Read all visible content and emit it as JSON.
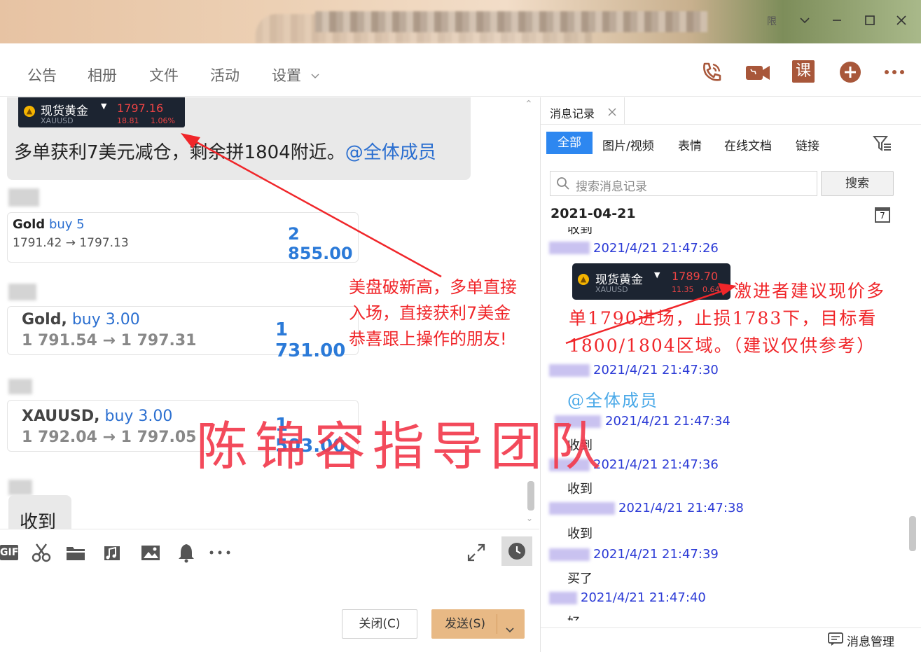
{
  "window": {
    "title_partial": "限",
    "controls": [
      "chevron-down-icon",
      "minimize-icon",
      "maximize-icon",
      "close-icon"
    ]
  },
  "toolbar": {
    "tabs": [
      "公告",
      "相册",
      "文件",
      "活动",
      "设置"
    ],
    "icons": [
      "phone-icon",
      "video-icon",
      "course-icon",
      "add-icon",
      "more-icon"
    ],
    "course_label": "课"
  },
  "chat": {
    "ticker1": {
      "name": "现货黄金",
      "symbol": "XAUUSD",
      "price": "1797.16",
      "change": "18.81",
      "pct": "1.06%"
    },
    "msg1_text": "多单获利7美元减仓，剩余拼1804附近。",
    "msg1_mention": "@全体成员",
    "trade1": {
      "sym": "Gold",
      "dir": "buy 5",
      "prices": "1791.42 → 1797.13",
      "profit": "2 855.00"
    },
    "trade2": {
      "sym": "Gold,",
      "dir": "buy 3.00",
      "prices": "1 791.54 → 1 797.31",
      "profit": "1 731.00"
    },
    "trade3": {
      "sym": "XAUUSD,",
      "dir": "buy 3.00",
      "prices": "1 792.04 → 1 797.05",
      "profit": "1 503.00"
    },
    "last_msg": "收到"
  },
  "input": {
    "tools": [
      "gif-icon",
      "scissors-icon",
      "folder-icon",
      "music-icon",
      "image-icon",
      "bell-icon",
      "more-icon"
    ],
    "gif_label": "GIF",
    "close_label": "关闭(C)",
    "send_label": "发送(S)"
  },
  "side": {
    "tab_title": "消息记录",
    "filters": [
      "全部",
      "图片/视频",
      "表情",
      "在线文档",
      "链接"
    ],
    "search_placeholder": "搜索消息记录",
    "search_button": "搜索",
    "date": "2021-04-21",
    "calendar_day": "7",
    "cut_top": "收到",
    "ticker2": {
      "name": "现货黄金",
      "symbol": "XAUUSD",
      "price": "1789.70",
      "change": "11.35",
      "pct": "0.64%"
    },
    "entries": [
      {
        "time": "2021/4/21 21:47:26"
      },
      {
        "time": "2021/4/21 21:47:30",
        "text": "@全体成员"
      },
      {
        "time": "2021/4/21 21:47:34",
        "text": "收到"
      },
      {
        "time": "2021/4/21 21:47:36",
        "text": "收到"
      },
      {
        "time": "2021/4/21 21:47:38",
        "text": "收到"
      },
      {
        "time": "2021/4/21 21:47:39",
        "text": "买了"
      },
      {
        "time": "2021/4/21 21:47:40",
        "text": "好"
      }
    ],
    "manage_label": "消息管理"
  },
  "annotations": {
    "left": [
      "美盘破新高，多单直接",
      "入场，直接获利7美金",
      "恭喜跟上操作的朋友!"
    ],
    "right": [
      "激进者建议现价多",
      "单1790进场，止损1783下，目标看",
      "1800/1804区域。（建议仅供参考）"
    ],
    "watermark": "陈锦容指导团队"
  },
  "colors": {
    "annotation_red": "#f0262a",
    "link_blue": "#2b6fd0",
    "send_button": "#e8b985",
    "active_filter": "#2d87f0"
  }
}
